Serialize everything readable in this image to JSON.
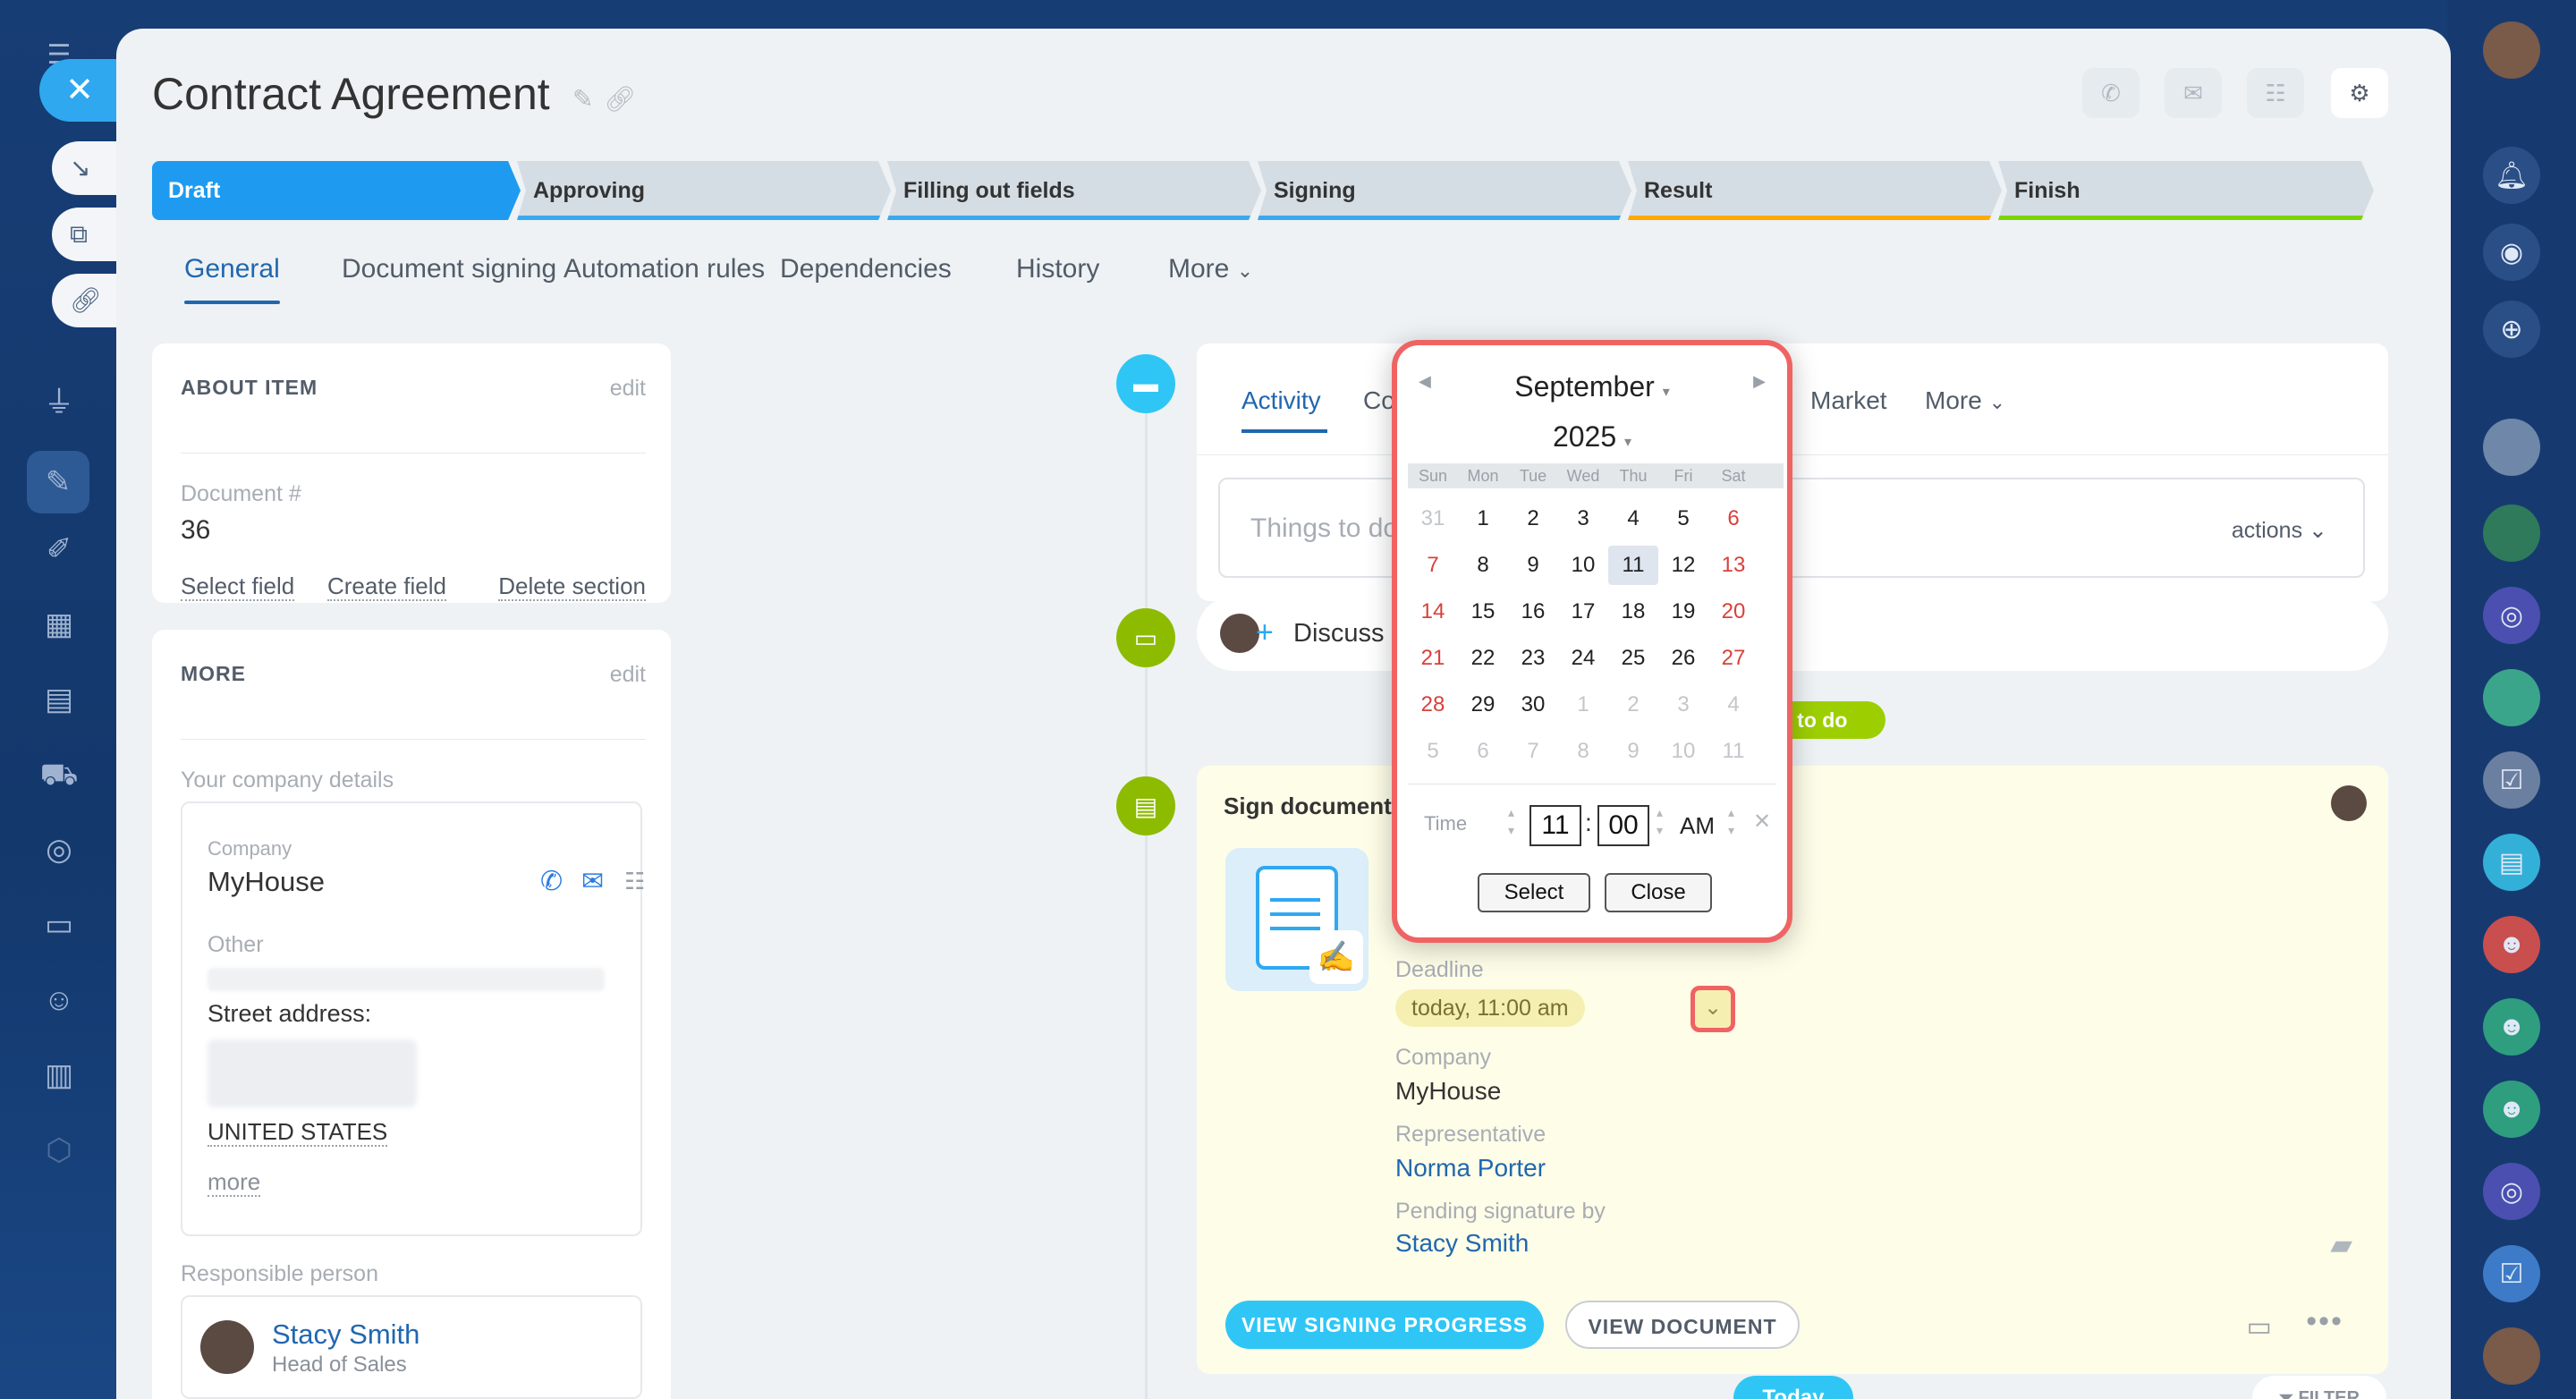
{
  "header": {
    "title": "Contract Agreement"
  },
  "stages": [
    {
      "label": "Draft",
      "color": "#1e9bf0"
    },
    {
      "label": "Approving",
      "color": "#39a8ef"
    },
    {
      "label": "Filling out fields",
      "color": "#39a8ef"
    },
    {
      "label": "Signing",
      "color": "#39a8ef"
    },
    {
      "label": "Result",
      "color": "#ffa900"
    },
    {
      "label": "Finish",
      "color": "#7bd500"
    }
  ],
  "tabs": [
    "General",
    "Document signing",
    "Automation rules",
    "Dependencies",
    "History",
    "More"
  ],
  "about": {
    "heading": "ABOUT ITEM",
    "edit": "edit",
    "doc_label": "Document #",
    "doc_value": "36",
    "select_field": "Select field",
    "create_field": "Create field",
    "delete_section": "Delete section"
  },
  "more_section": {
    "heading": "MORE",
    "edit": "edit",
    "company_details": "Your company details",
    "company_label": "Company",
    "company_value": "MyHouse",
    "other_label": "Other",
    "street_label": "Street address:",
    "country": "UNITED STATES",
    "more_link": "more",
    "responsible_label": "Responsible person",
    "person_name": "Stacy Smith",
    "person_title": "Head of Sales"
  },
  "activity": {
    "tabs": [
      "Activity",
      "Co",
      "Market",
      "More"
    ],
    "input_placeholder": "Things to do",
    "actions_label": "actions",
    "discuss": "Discuss",
    "todo_badge": "s to do"
  },
  "sign": {
    "title": "Sign document",
    "deadline_label": "Deadline",
    "deadline_value": "today, 11:00 am",
    "company_label": "Company",
    "company_value": "MyHouse",
    "rep_label": "Representative",
    "rep_value": "Norma Porter",
    "pending_label": "Pending signature by",
    "pending_value": "Stacy Smith",
    "btn_progress": "VIEW SIGNING PROGRESS",
    "btn_document": "VIEW DOCUMENT"
  },
  "footer": {
    "today": "Today",
    "filter": "FILTER"
  },
  "calendar": {
    "month": "September",
    "year": "2025",
    "dow": [
      "Sun",
      "Mon",
      "Tue",
      "Wed",
      "Thu",
      "Fri",
      "Sat"
    ],
    "weeks": [
      [
        "31",
        "1",
        "2",
        "3",
        "4",
        "5",
        "6"
      ],
      [
        "7",
        "8",
        "9",
        "10",
        "11",
        "12",
        "13"
      ],
      [
        "14",
        "15",
        "16",
        "17",
        "18",
        "19",
        "20"
      ],
      [
        "21",
        "22",
        "23",
        "24",
        "25",
        "26",
        "27"
      ],
      [
        "28",
        "29",
        "30",
        "1",
        "2",
        "3",
        "4"
      ],
      [
        "5",
        "6",
        "7",
        "8",
        "9",
        "10",
        "11"
      ]
    ],
    "selected_day": "11",
    "time_label": "Time",
    "hour": "11",
    "minute": "00",
    "ampm": "AM",
    "select_btn": "Select",
    "close_btn": "Close"
  }
}
